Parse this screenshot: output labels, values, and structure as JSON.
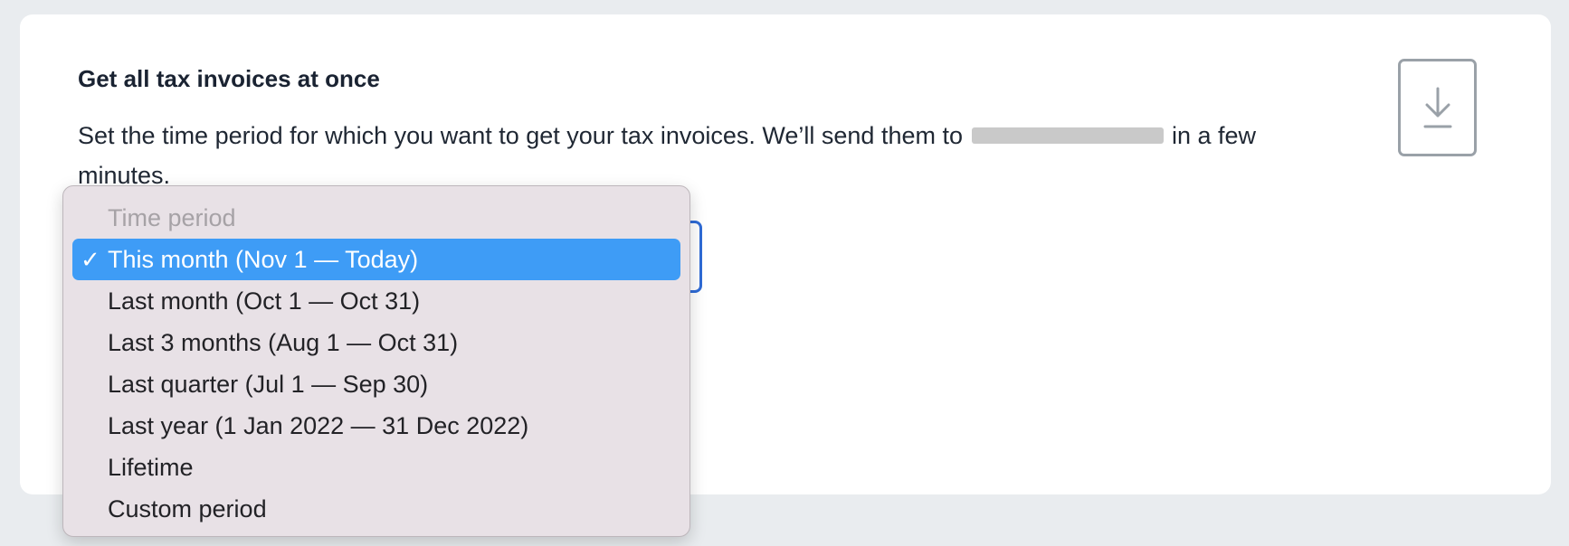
{
  "card": {
    "title": "Get all tax invoices at once",
    "description_before": "Set the time period for which you want to get your tax invoices. We’ll send them to ",
    "description_after": " in a few minutes."
  },
  "download": {
    "icon": "download-icon"
  },
  "dropdown": {
    "header": "Time period",
    "check_glyph": "✓",
    "options": [
      {
        "label": "This month (Nov 1 — Today)",
        "selected": true
      },
      {
        "label": "Last month (Oct 1 — Oct 31)",
        "selected": false
      },
      {
        "label": "Last 3 months (Aug 1 — Oct 31)",
        "selected": false
      },
      {
        "label": "Last quarter (Jul 1 — Sep 30)",
        "selected": false
      },
      {
        "label": "Last year (1 Jan 2022 — 31 Dec 2022)",
        "selected": false
      },
      {
        "label": "Lifetime",
        "selected": false
      },
      {
        "label": "Custom period",
        "selected": false
      }
    ]
  },
  "colors": {
    "accent": "#3e9cf6",
    "focus_border": "#2e6bd6",
    "page_bg": "#e9ecef"
  }
}
